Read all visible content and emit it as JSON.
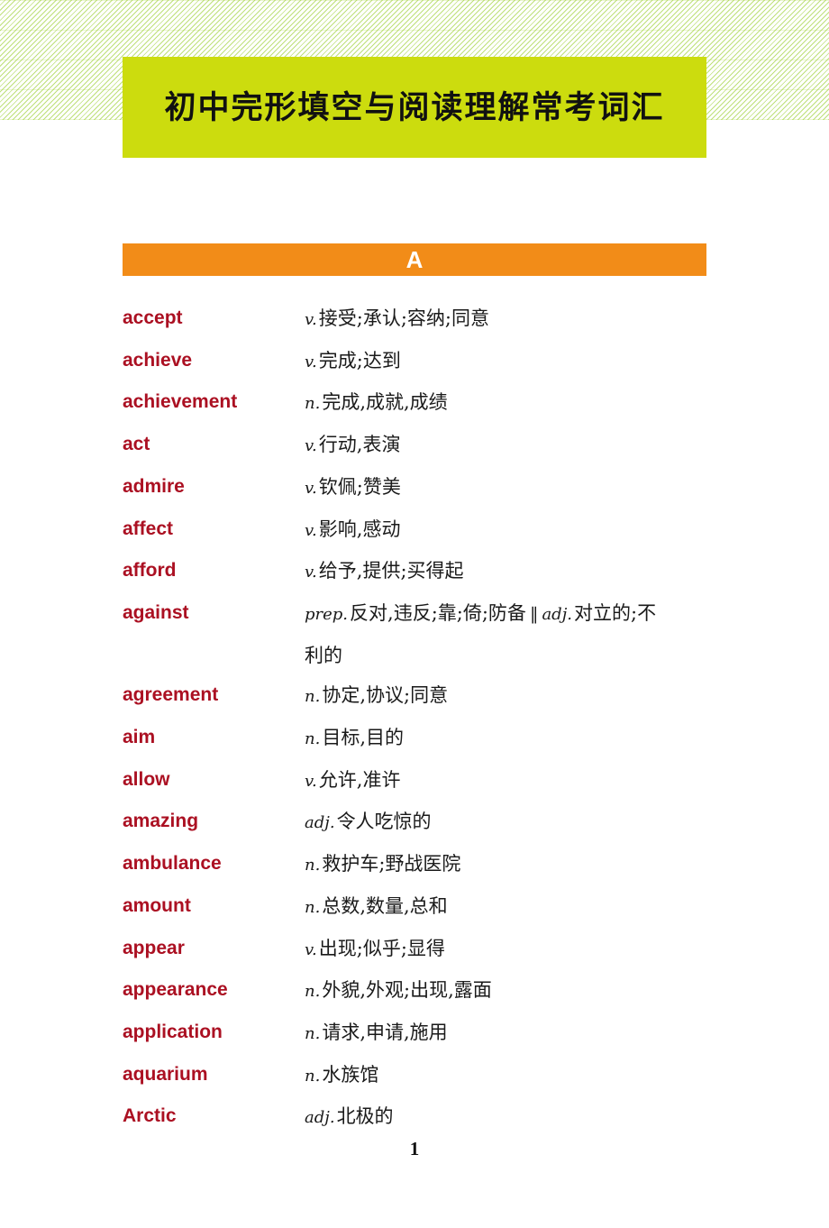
{
  "document": {
    "title": "初中完形填空与阅读理解常考词汇",
    "page_number": "1"
  },
  "colors": {
    "title_banner_bg": "#ccdc0e",
    "section_banner_bg": "#f28c18",
    "section_letter": "#ffffff",
    "word_color": "#ab1022",
    "definition_color": "#1a1a1a",
    "hatch_accent": "#96cd28",
    "page_bg": "#ffffff"
  },
  "section": {
    "letter": "A"
  },
  "entries": [
    {
      "word": "accept",
      "pos": "v.",
      "meaning": "接受;承认;容纳;同意"
    },
    {
      "word": "achieve",
      "pos": "v.",
      "meaning": "完成;达到"
    },
    {
      "word": "achievement",
      "pos": "n.",
      "meaning": "完成,成就,成绩"
    },
    {
      "word": "act",
      "pos": "v.",
      "meaning": "行动,表演"
    },
    {
      "word": "admire",
      "pos": "v.",
      "meaning": "钦佩;赞美"
    },
    {
      "word": "affect",
      "pos": "v.",
      "meaning": "影响,感动"
    },
    {
      "word": "afford",
      "pos": "v.",
      "meaning": "给予,提供;买得起"
    },
    {
      "word": "against",
      "pos": "prep.",
      "meaning": "反对,违反;靠;倚;防备",
      "separator": "‖",
      "pos2": "adj.",
      "meaning2": "对立的;不利的"
    },
    {
      "word": "agreement",
      "pos": "n.",
      "meaning": "协定,协议;同意"
    },
    {
      "word": "aim",
      "pos": "n.",
      "meaning": "目标,目的"
    },
    {
      "word": "allow",
      "pos": "v.",
      "meaning": "允许,准许"
    },
    {
      "word": "amazing",
      "pos": "adj.",
      "meaning": "令人吃惊的"
    },
    {
      "word": "ambulance",
      "pos": "n.",
      "meaning": "救护车;野战医院"
    },
    {
      "word": "amount",
      "pos": "n.",
      "meaning": "总数,数量,总和"
    },
    {
      "word": "appear",
      "pos": "v.",
      "meaning": "出现;似乎;显得"
    },
    {
      "word": "appearance",
      "pos": "n.",
      "meaning": "外貌,外观;出现,露面"
    },
    {
      "word": "application",
      "pos": "n.",
      "meaning": "请求,申请,施用"
    },
    {
      "word": "aquarium",
      "pos": "n.",
      "meaning": "水族馆"
    },
    {
      "word": "Arctic",
      "pos": "adj.",
      "meaning": "北极的"
    }
  ]
}
